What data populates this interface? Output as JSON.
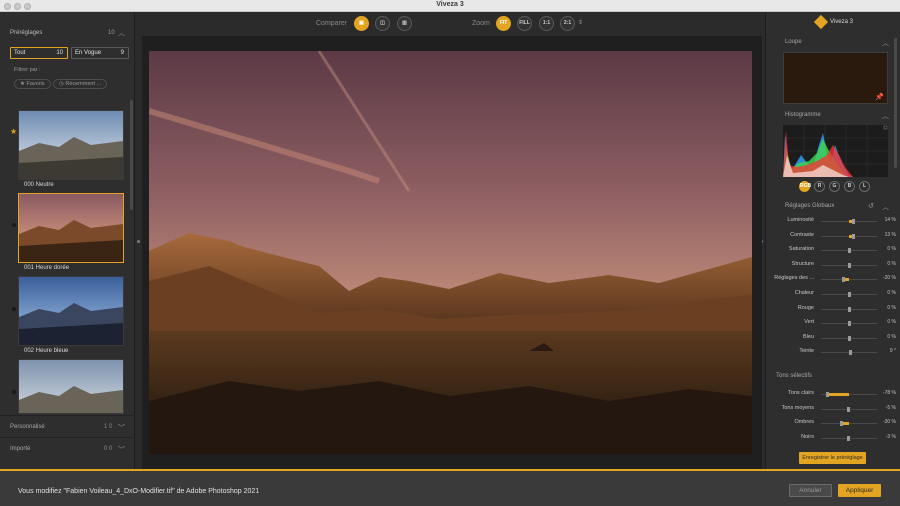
{
  "window": {
    "title": "Viveza 3"
  },
  "left": {
    "presets_title": "Préréglages",
    "presets_count": "10",
    "tabs": [
      {
        "label": "Tout",
        "count": "10"
      },
      {
        "label": "En Vogue",
        "count": "9"
      }
    ],
    "filter_label": "Filtrer par :",
    "chips": [
      "Favoris",
      "Récemment ..."
    ],
    "thumbs": [
      {
        "label": "000 Neutre"
      },
      {
        "label": "001 Heure dorée"
      },
      {
        "label": "002 Heure bleue"
      }
    ],
    "rows": [
      {
        "label": "Personnalisé",
        "count": "1 0"
      },
      {
        "label": "Importé",
        "count": "0 0"
      }
    ]
  },
  "toolbar": {
    "compare_label": "Comparer",
    "zoom_label": "Zoom",
    "zoom_options": [
      "FIT",
      "FILL",
      "1:1",
      "2:1"
    ],
    "zoom_selected": "FIT"
  },
  "right": {
    "brand": "Viveza 3",
    "loupe_title": "Loupe",
    "histo_title": "Histogramme",
    "channels": [
      "RGB",
      "R",
      "G",
      "B",
      "L"
    ],
    "global_title": "Réglages Globaux",
    "adjustments": [
      {
        "label": "Luminosité",
        "value": "14 %",
        "level": 0.14
      },
      {
        "label": "Contraste",
        "value": "13 %",
        "level": 0.13
      },
      {
        "label": "Saturation",
        "value": "0 %",
        "level": 0
      },
      {
        "label": "Structure",
        "value": "0 %",
        "level": 0
      },
      {
        "label": "Réglages des ...",
        "value": "-20 %",
        "level": -0.2
      },
      {
        "label": "Chaleur",
        "value": "0 %",
        "level": 0
      },
      {
        "label": "Rouge",
        "value": "0 %",
        "level": 0
      },
      {
        "label": "Vert",
        "value": "0 %",
        "level": 0
      },
      {
        "label": "Bleu",
        "value": "0 %",
        "level": 0
      },
      {
        "label": "Teinte",
        "value": "9 °",
        "level": 0.05
      }
    ],
    "selective_title": "Tons sélectifs",
    "tones": [
      {
        "label": "Tons clairs",
        "value": "-78 %",
        "level": -0.78
      },
      {
        "label": "Tons moyens",
        "value": "-5 %",
        "level": -0.05
      },
      {
        "label": "Ombres",
        "value": "-30 %",
        "level": -0.3
      },
      {
        "label": "Noirs",
        "value": "-3 %",
        "level": -0.03
      }
    ],
    "save_preset": "Enregistrer le préréglage"
  },
  "bottom": {
    "status": "Vous modifiez \"Fabien Voileau_4_DxO-Modifier.tif\" de Adobe Photoshop 2021",
    "cancel": "Annuler",
    "apply": "Appliquer"
  },
  "colors": {
    "accent": "#e3a521"
  }
}
